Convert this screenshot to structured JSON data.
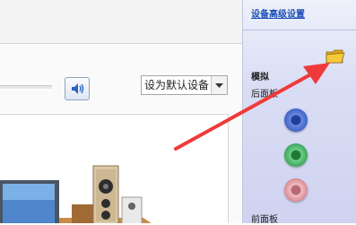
{
  "side_panel": {
    "advanced_settings_link": "设备高级设置",
    "analog_label": "模拟",
    "rear_panel_label": "后面板",
    "front_panel_label": "前面板",
    "jacks": [
      {
        "name": "rear-jack-blue",
        "color": "#3f63c9"
      },
      {
        "name": "rear-jack-green",
        "color": "#3aa65a"
      },
      {
        "name": "rear-jack-pink",
        "color": "#d98a93"
      }
    ],
    "folder_icon": "folder-icon"
  },
  "main_panel": {
    "default_device_select": "设为默认设备",
    "speaker_icon": "speaker-volume-icon"
  },
  "annotation": {
    "arrow_color": "#ee3a3a"
  }
}
